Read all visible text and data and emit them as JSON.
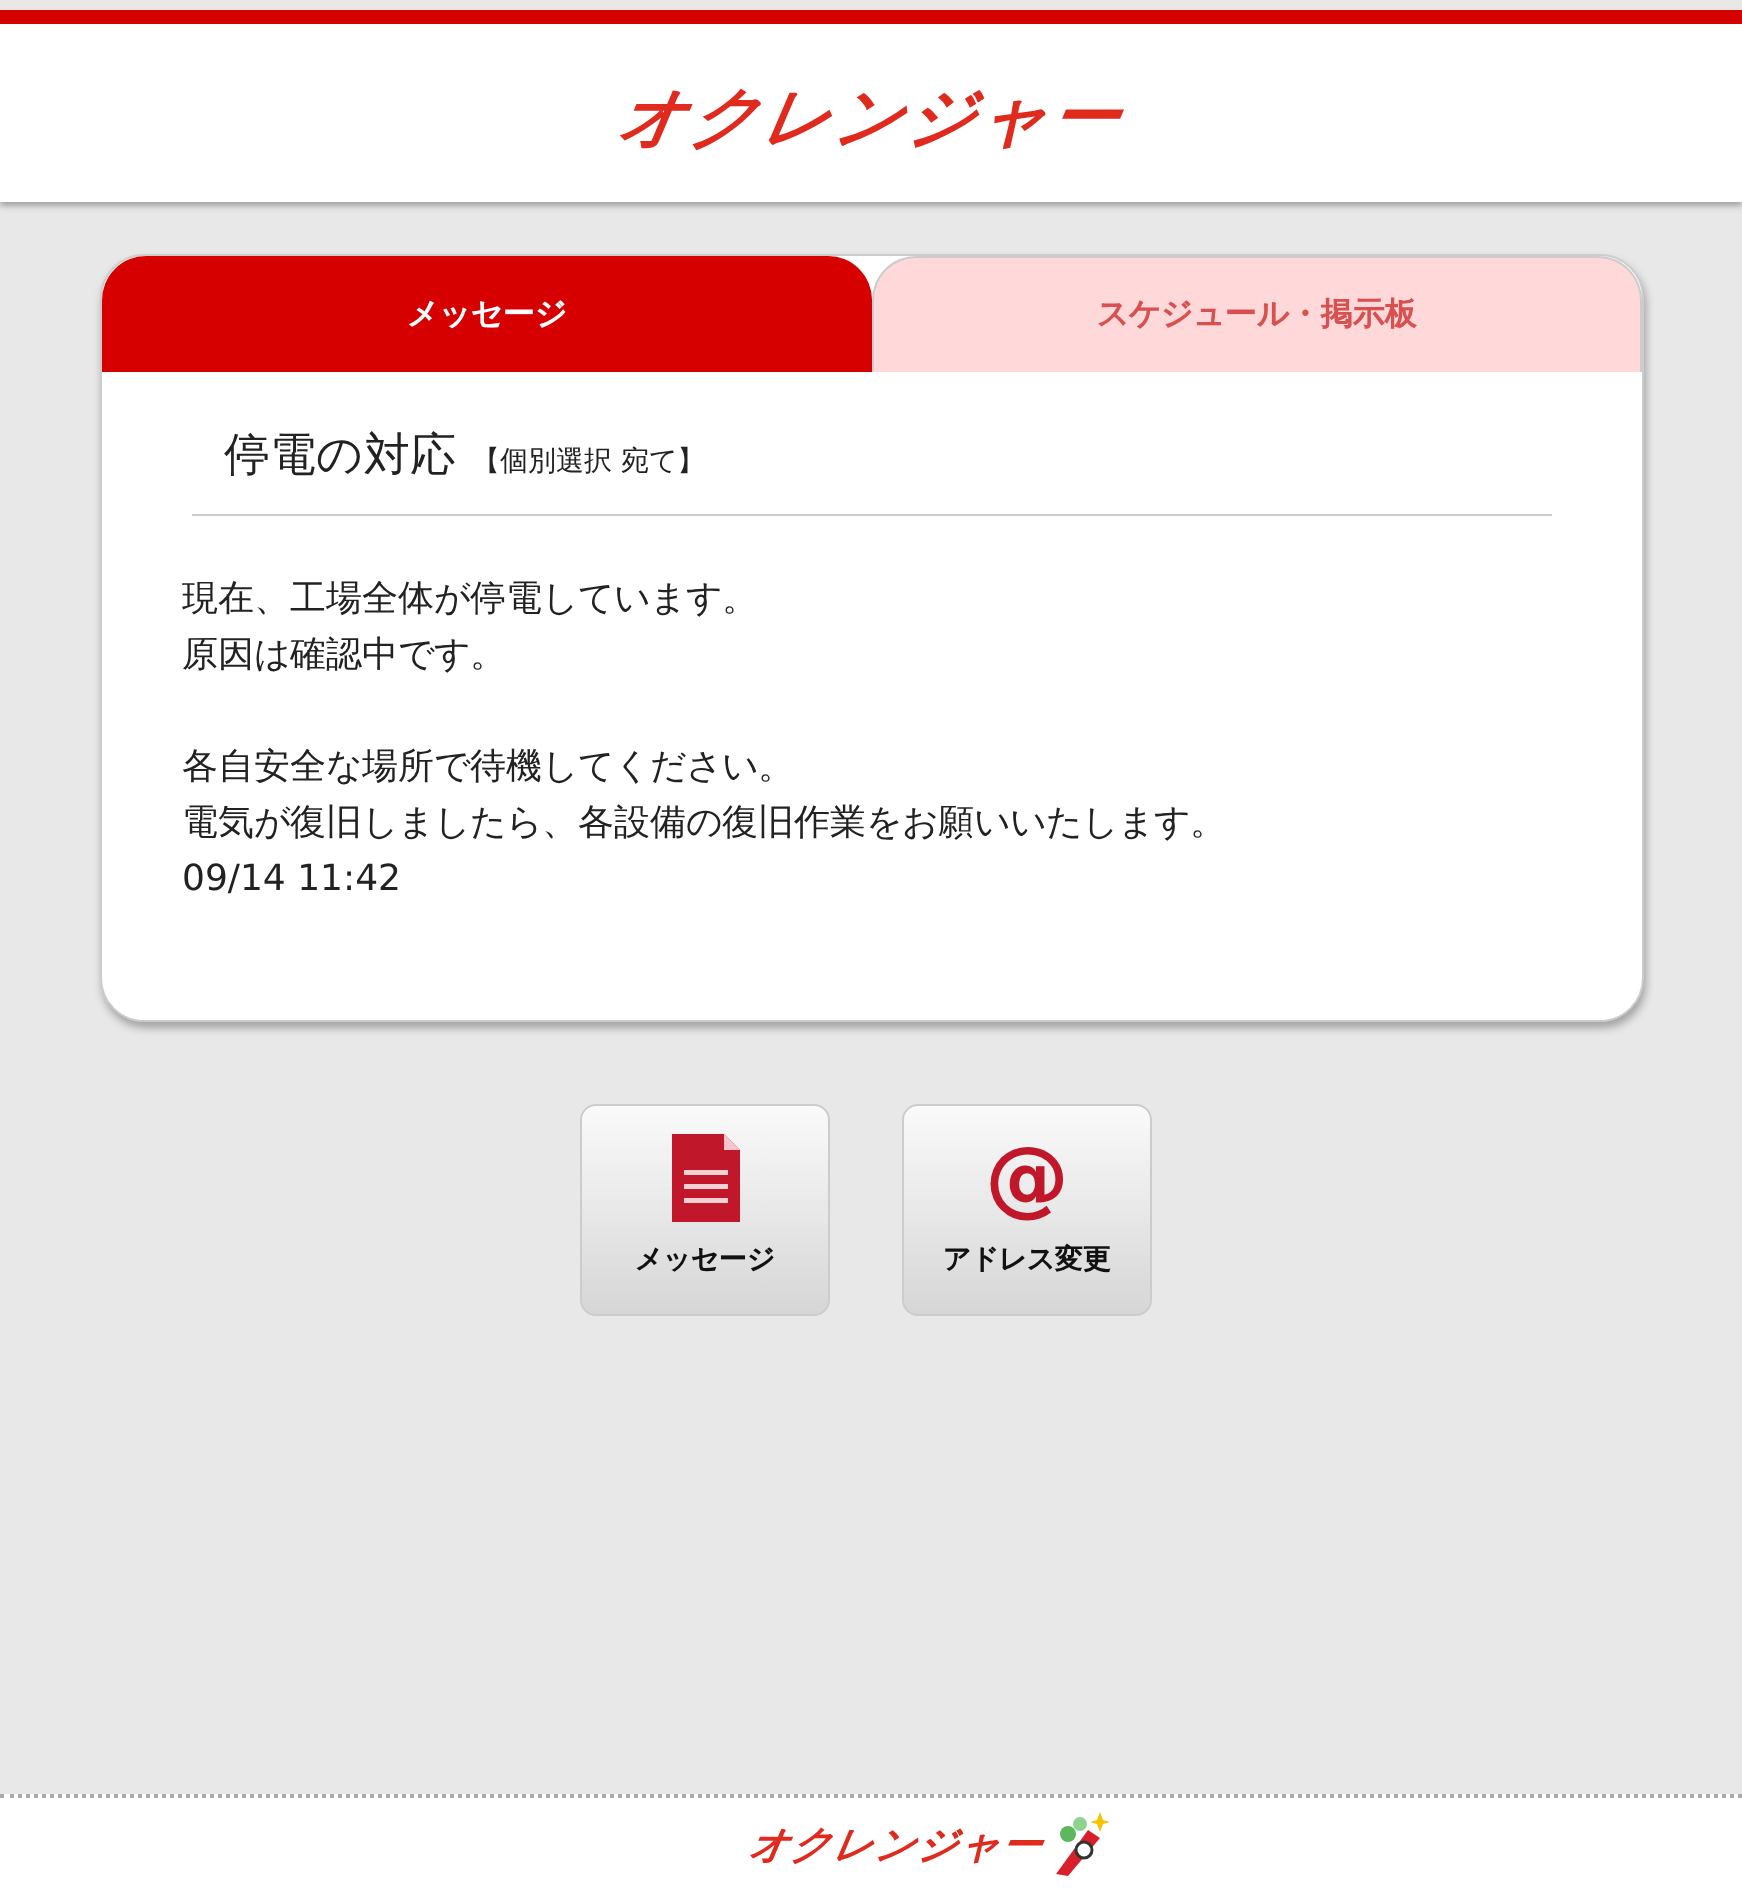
{
  "header": {
    "logo": "オクレンジャー"
  },
  "tabs": [
    {
      "label": "メッセージ",
      "selected": true
    },
    {
      "label": "スケジュール・掲示板",
      "selected": false
    }
  ],
  "message": {
    "title": "停電の対応",
    "recipient": "【個別選択 宛て】",
    "paragraphs": [
      [
        "現在、工場全体が停電しています。",
        "原因は確認中です。"
      ],
      [
        "各自安全な場所で待機してください。",
        "電気が復旧しましたら、各設備の復旧作業をお願いいたします。",
        "09/14 11:42"
      ]
    ]
  },
  "buttons": [
    {
      "kind": "document",
      "label": "メッセージ"
    },
    {
      "kind": "glyph",
      "glyph": "@",
      "label": "アドレス変更"
    }
  ],
  "footer": {
    "logo": "オクレンジャー"
  }
}
